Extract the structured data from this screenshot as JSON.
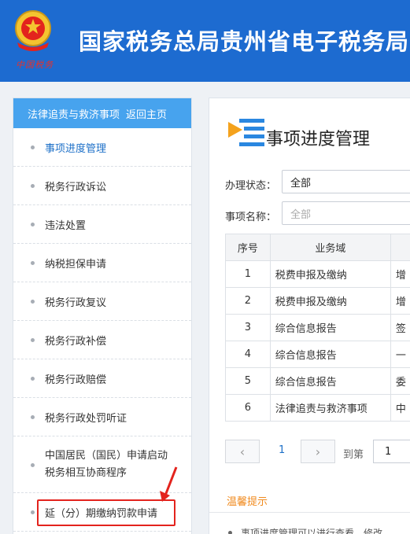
{
  "header": {
    "site_title": "国家税务总局贵州省电子税务局",
    "emblem_caption": "中国税务"
  },
  "sidebar": {
    "header_title": "法律追责与救济事项",
    "back_home": "返回主页",
    "items": [
      {
        "label": "事项进度管理"
      },
      {
        "label": "税务行政诉讼"
      },
      {
        "label": "违法处置"
      },
      {
        "label": "纳税担保申请"
      },
      {
        "label": "税务行政复议"
      },
      {
        "label": "税务行政补偿"
      },
      {
        "label": "税务行政赔偿"
      },
      {
        "label": "税务行政处罚听证"
      },
      {
        "label": "中国居民（国民）申请启动税务相互协商程序"
      },
      {
        "label": "延（分）期缴纳罚款申请"
      }
    ]
  },
  "main": {
    "title": "事项进度管理",
    "filters": {
      "status_label": "办理状态：",
      "status_value": "全部",
      "name_label": "事项名称：",
      "name_placeholder": "全部"
    },
    "table": {
      "headers": [
        "序号",
        "业务域",
        ""
      ],
      "rows": [
        {
          "no": "1",
          "domain": "税费申报及缴纳",
          "more": "增"
        },
        {
          "no": "2",
          "domain": "税费申报及缴纳",
          "more": "增"
        },
        {
          "no": "3",
          "domain": "综合信息报告",
          "more": "签"
        },
        {
          "no": "4",
          "domain": "综合信息报告",
          "more": "一"
        },
        {
          "no": "5",
          "domain": "综合信息报告",
          "more": "委"
        },
        {
          "no": "6",
          "domain": "法律追责与救济事项",
          "more": "中"
        }
      ]
    },
    "pagination": {
      "prev": "‹",
      "page": "1",
      "next": "›",
      "goto_label": "到第",
      "goto_value": "1"
    },
    "tips": {
      "title": "温馨提示",
      "text": "事项进度管理可以进行查看、修改、"
    }
  },
  "colors": {
    "header_bg": "#1d6bd0",
    "sidebar_head_bg": "#47a3ee",
    "active_link": "#1d70c8",
    "highlight_box": "#e3231d",
    "tips_title": "#f08a1e"
  },
  "icons": [
    "national-tax-emblem-icon",
    "page-title-list-icon",
    "red-arrow-annotation-icon",
    "chevron-left-icon",
    "chevron-right-icon"
  ]
}
